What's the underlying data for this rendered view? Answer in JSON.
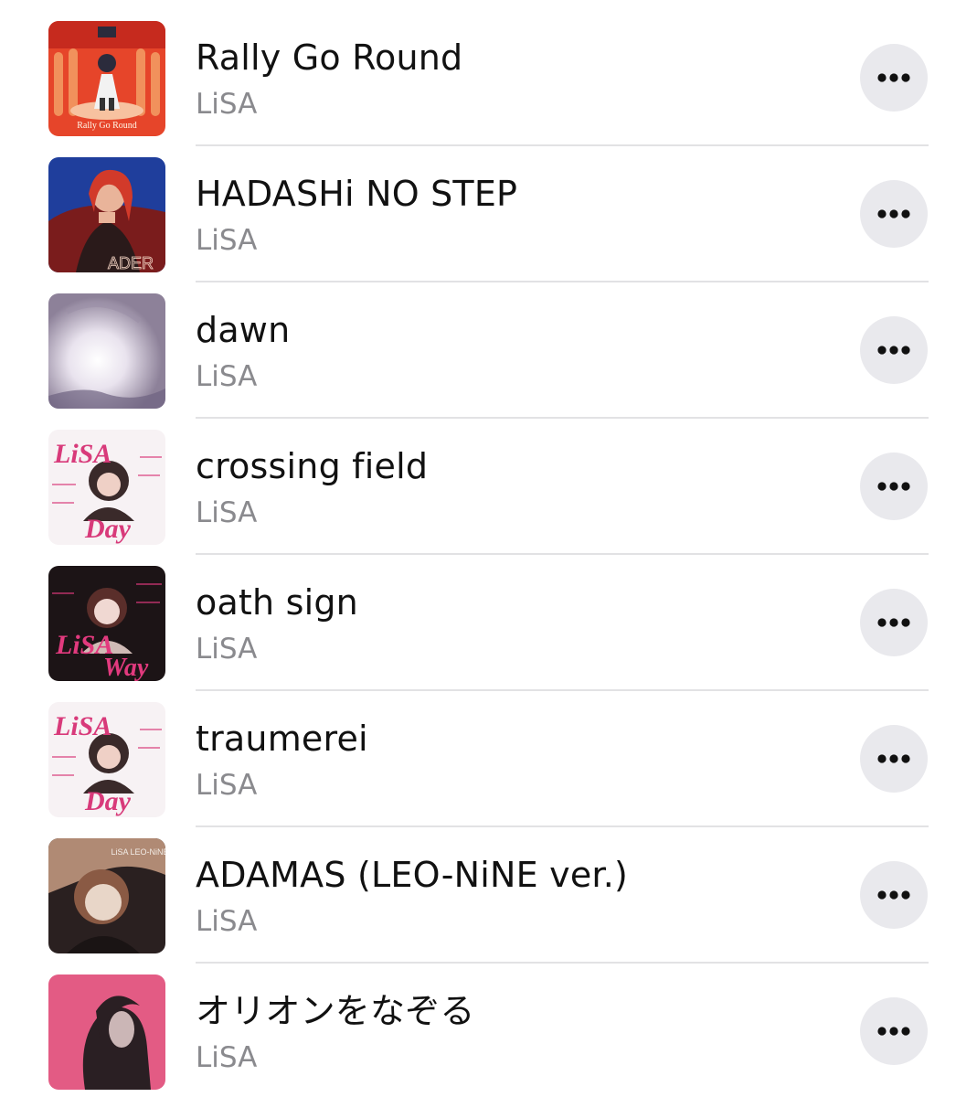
{
  "songs": [
    {
      "title": "Rally Go Round",
      "artist": "LiSA",
      "artwork": "artwork-rally-go-round",
      "art_colors": [
        "#e6452a",
        "#f39a62",
        "#c62a1e"
      ],
      "art_text": "Rally Go Round"
    },
    {
      "title": "HADASHi NO STEP",
      "artist": "LiSA",
      "artwork": "artwork-hadashi-no-step",
      "art_colors": [
        "#1f3e9c",
        "#d23a2a",
        "#2a1a1a"
      ],
      "art_text": "ADER"
    },
    {
      "title": "dawn",
      "artist": "LiSA",
      "artwork": "artwork-dawn",
      "art_colors": [
        "#c9c3d3",
        "#f4f1f6",
        "#7b6e88"
      ],
      "art_text": ""
    },
    {
      "title": "crossing field",
      "artist": "LiSA",
      "artwork": "artwork-lisa-best-day",
      "art_colors": [
        "#f7f2f4",
        "#d83a7a",
        "#3a2a2a"
      ],
      "art_text": "LiSA"
    },
    {
      "title": "oath sign",
      "artist": "LiSA",
      "artwork": "artwork-lisa-best-way",
      "art_colors": [
        "#1c1416",
        "#e23a7e",
        "#f0d8d2"
      ],
      "art_text": "LiSA"
    },
    {
      "title": "traumerei",
      "artist": "LiSA",
      "artwork": "artwork-lisa-best-day",
      "art_colors": [
        "#f7f2f4",
        "#d83a7a",
        "#3a2a2a"
      ],
      "art_text": "LiSA"
    },
    {
      "title": "ADAMAS (LEO-NiNE ver.)",
      "artist": "LiSA",
      "artwork": "artwork-leo-nine",
      "art_colors": [
        "#b08a74",
        "#2a2020",
        "#e8d6c8"
      ],
      "art_text": "LiSA LEO-NiNE"
    },
    {
      "title": "オリオンをなぞる",
      "artist": "LiSA",
      "artwork": "artwork-orion-wo-nazoru",
      "art_colors": [
        "#e2557f",
        "#1a1416",
        "#f0a7bd"
      ],
      "art_text": ""
    }
  ],
  "more_icon": "more-ellipsis-icon",
  "colors": {
    "title": "#111111",
    "subtitle": "#8a8a8e",
    "button_bg": "#e9e9ed",
    "separator": "#e2e2e4"
  }
}
